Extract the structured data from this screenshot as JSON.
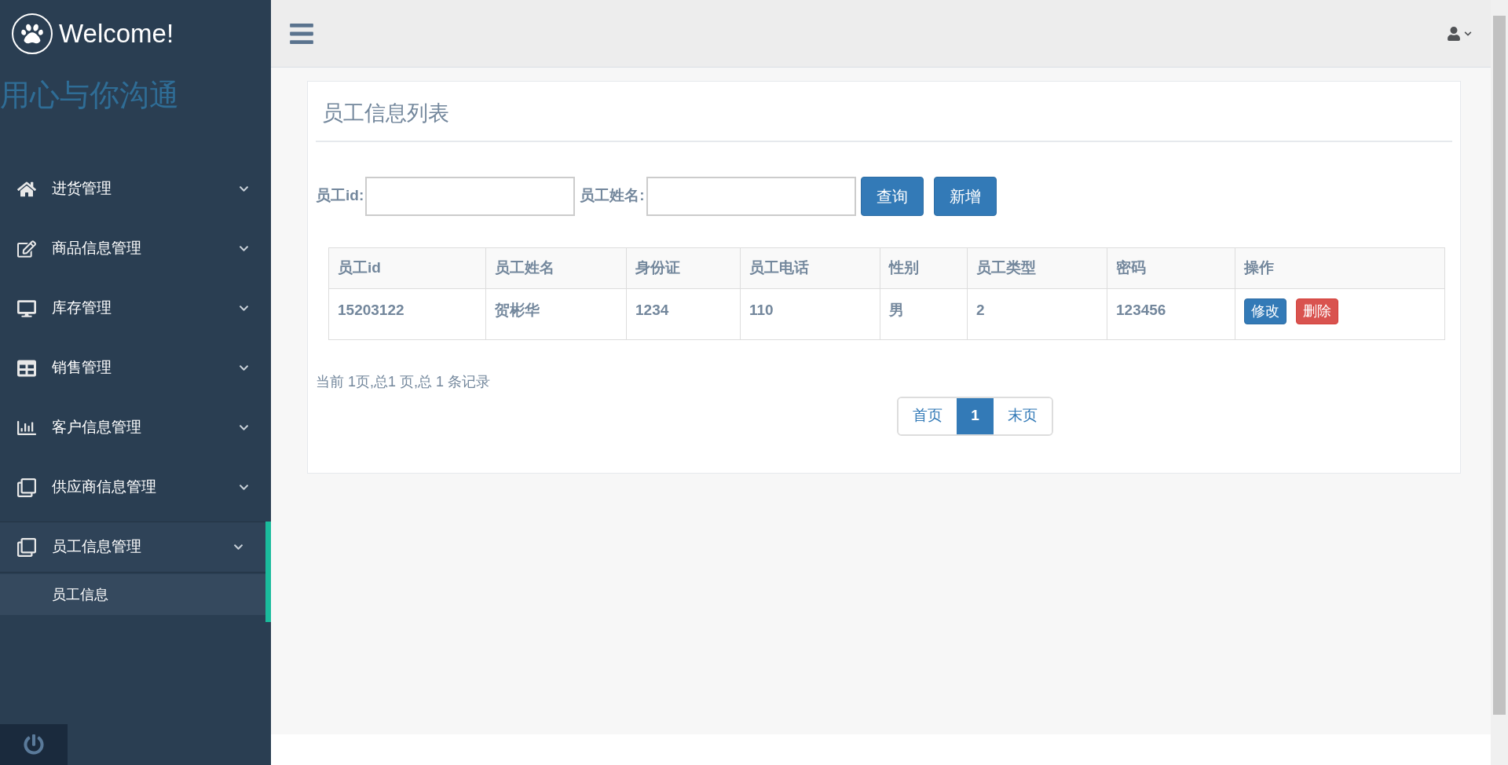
{
  "brand": {
    "title": "Welcome!",
    "slogan": "用心与你沟通"
  },
  "sidebar": {
    "items": [
      {
        "label": "进货管理",
        "selected": false
      },
      {
        "label": "商品信息管理",
        "selected": false
      },
      {
        "label": "库存管理",
        "selected": false
      },
      {
        "label": "销售管理",
        "selected": false
      },
      {
        "label": "客户信息管理",
        "selected": false
      },
      {
        "label": "供应商信息管理",
        "selected": false
      },
      {
        "label": "员工信息管理",
        "selected": true,
        "children": [
          {
            "label": "员工信息",
            "selected": true
          }
        ]
      }
    ]
  },
  "panel": {
    "title": "员工信息列表",
    "search": [
      {
        "label": "员工id:"
      },
      {
        "label": "员工姓名:"
      }
    ],
    "buttons": [
      "查询",
      "新增"
    ],
    "table": {
      "columns": [
        "员工id",
        "员工姓名",
        "身份证",
        "员工电话",
        "性别",
        "员工类型",
        "密码",
        "操作"
      ],
      "rows": [
        {
          "cells": [
            "15203122",
            "贺彬华",
            "1234",
            "110",
            "男",
            "2",
            "123456"
          ],
          "actions": [
            {
              "label": "修改",
              "kind": "edit"
            },
            {
              "label": "删除",
              "kind": "delete"
            }
          ]
        }
      ]
    },
    "summary": "当前 1页,总1 页,总 1 条记录",
    "pagination": [
      {
        "label": "首页",
        "selected": false
      },
      {
        "label": "1",
        "selected": true
      },
      {
        "label": "末页",
        "selected": false
      }
    ]
  }
}
